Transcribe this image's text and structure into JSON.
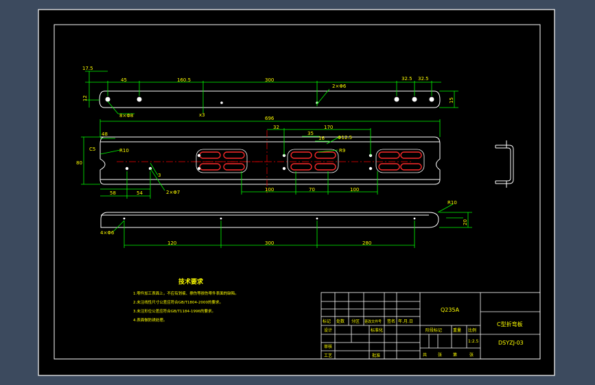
{
  "colors": {
    "background": "#3c4a5e",
    "sheet": "#000000",
    "frame": "#ffffff",
    "dimension": "#00ff00",
    "text": "#ffff00",
    "centerline": "#ff0000",
    "slot": "#ff2a2a",
    "part": "#ffffff"
  },
  "top_view": {
    "dims": [
      "17.5",
      "45",
      "160.5",
      "300",
      "32.5",
      "32.5"
    ],
    "left_height": "12",
    "right_height": "15",
    "note_hole": "2×Φ6",
    "note_bottom": "8×Φ8",
    "small_dim": "x3"
  },
  "front_view": {
    "overall": "696",
    "dims_top": [
      "48",
      "32",
      "35",
      "16",
      "Φ12.5",
      "170",
      "R9"
    ],
    "radius": "R10",
    "left_height": "C5",
    "left_dim": "80",
    "bottom": [
      "58",
      "54",
      "100",
      "70",
      "100"
    ],
    "note_hole": "2×Φ7",
    "small_dim": "3"
  },
  "side_view": {
    "radius": "R10",
    "height": "20",
    "holes_note": "4×Φ6",
    "dims": [
      "120",
      "300",
      "280"
    ]
  },
  "tech_requirements": {
    "title": "技术要求",
    "items": [
      "1.零件加工表面上，不应有划痕、擦伤等损伤零件表面的缺陷。",
      "2.未注线性尺寸公差应符合GB/T1804-2000的要求。",
      "3.未注形位公差应符合GB/T1184-1996的要求。",
      "4.表面做防锈处理。"
    ]
  },
  "title_block": {
    "material": "Q235A",
    "part_name": "C型折弯板",
    "drawing_no": "DSYZJ-03",
    "scale": "1:2.5",
    "row_labels": [
      "标记",
      "处数",
      "分区",
      "更改文件号",
      "签名",
      "年.月.日"
    ],
    "designer": "设计",
    "standard": "标准化",
    "stage_label": "阶段标记",
    "weight_label": "重量",
    "scale_label": "比例",
    "reviewer": "审核",
    "process": "工艺",
    "approve": "批准",
    "sheet_info": [
      "共",
      "张",
      "第",
      "张"
    ]
  }
}
